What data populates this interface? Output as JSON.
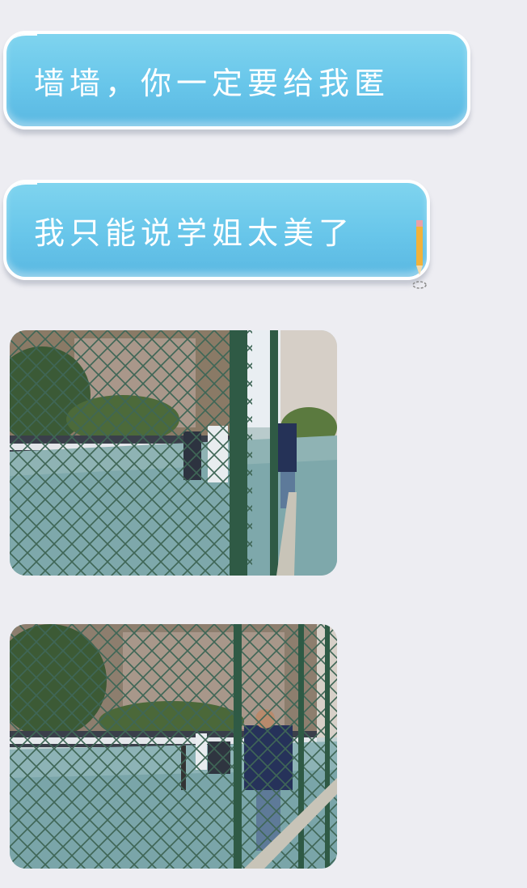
{
  "messages": [
    {
      "type": "text",
      "text": "墙墙，你一定要给我匿"
    },
    {
      "type": "text",
      "text": "我只能说学姐太美了"
    },
    {
      "type": "image",
      "description_icon": "photo-icon"
    },
    {
      "type": "image",
      "description_icon": "photo-icon"
    }
  ],
  "colors": {
    "background": "#ededf2",
    "bubble": "#68c6ea",
    "bubble_border": "#ffffff",
    "text": "#ffffff"
  }
}
